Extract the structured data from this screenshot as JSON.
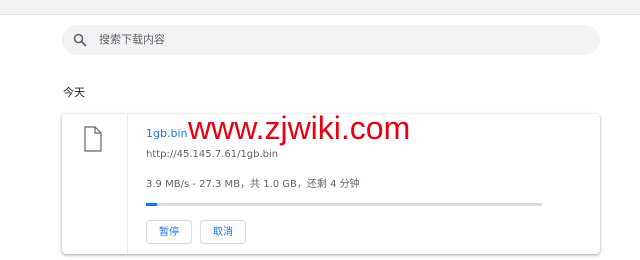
{
  "search": {
    "placeholder": "搜索下载内容",
    "icon": "search-icon"
  },
  "section": {
    "title": "今天"
  },
  "download": {
    "file_name": "1gb.bin",
    "url": "http://45.145.7.61/1gb.bin",
    "status": "3.9 MB/s - 27.3 MB，共 1.0 GB，还剩 4 分钟",
    "progress_fraction": 0.0273,
    "pause_label": "暂停",
    "cancel_label": "取消",
    "file_icon": "file-icon"
  },
  "watermark": {
    "text": "www.zjwiki.com"
  },
  "colors": {
    "accent": "#1a73e8",
    "watermark": "#e60012",
    "track": "#dadce0"
  }
}
